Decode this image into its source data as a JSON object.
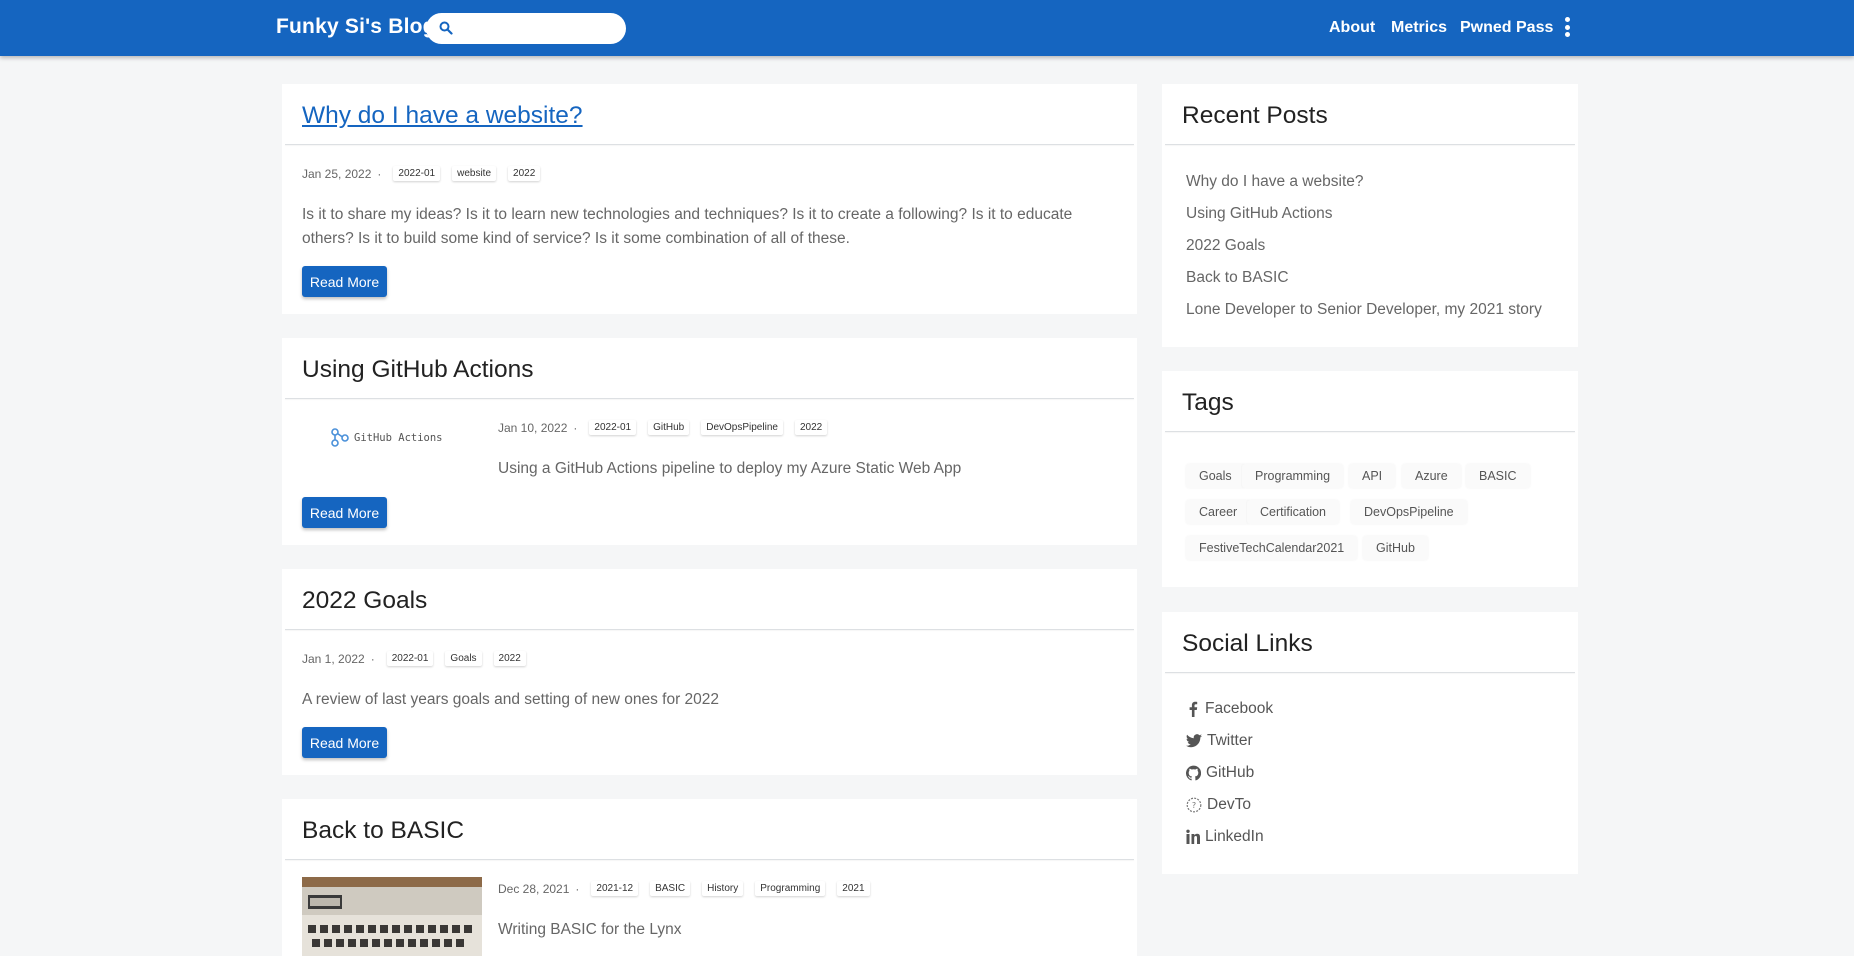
{
  "navbar": {
    "brand": "Funky Si's Blog",
    "search_placeholder": "",
    "links": [
      "About",
      "Metrics",
      "Pwned Pass"
    ]
  },
  "posts": [
    {
      "title": "Why do I have a website?",
      "date": "Jan 25, 2022",
      "tags": [
        "2022-01",
        "website",
        "2022"
      ],
      "description": "Is it to share my ideas? Is it to learn new technologies and techniques? Is it to create a following? Is it to educate others? Is it to build some kind of service? Is it some combination of all of these.",
      "read_more": "Read More"
    },
    {
      "title": "Using GitHub Actions",
      "date": "Jan 10, 2022",
      "tags": [
        "2022-01",
        "GitHub",
        "DevOpsPipeline",
        "2022"
      ],
      "thumbnail_text": "GitHub Actions",
      "description": "Using a GitHub Actions pipeline to deploy my Azure Static Web App",
      "read_more": "Read More"
    },
    {
      "title": "2022 Goals",
      "date": "Jan 1, 2022",
      "tags": [
        "2022-01",
        "Goals",
        "2022"
      ],
      "description": "A review of last years goals and setting of new ones for 2022",
      "read_more": "Read More"
    },
    {
      "title": "Back to BASIC",
      "date": "Dec 28, 2021",
      "tags": [
        "2021-12",
        "BASIC",
        "History",
        "Programming",
        "2021"
      ],
      "description": "Writing BASIC for the Lynx"
    }
  ],
  "sidebar": {
    "recent_title": "Recent Posts",
    "recent": [
      "Why do I have a website?",
      "Using GitHub Actions",
      "2022 Goals",
      "Back to BASIC",
      "Lone Developer to Senior Developer, my 2021 story"
    ],
    "tags_title": "Tags",
    "tags": [
      "Goals",
      "Programming",
      "API",
      "Azure",
      "BASIC",
      "Career",
      "Certification",
      "DevOpsPipeline",
      "FestiveTechCalendar2021",
      "GitHub"
    ],
    "social_title": "Social Links",
    "social": [
      {
        "label": "Facebook",
        "icon": "facebook-icon"
      },
      {
        "label": "Twitter",
        "icon": "twitter-icon"
      },
      {
        "label": "GitHub",
        "icon": "github-icon"
      },
      {
        "label": "DevTo",
        "icon": "devto-icon"
      },
      {
        "label": "LinkedIn",
        "icon": "linkedin-icon"
      }
    ]
  },
  "colors": {
    "primary": "#1565c0",
    "background": "#f5f6f7",
    "card": "#ffffff"
  }
}
